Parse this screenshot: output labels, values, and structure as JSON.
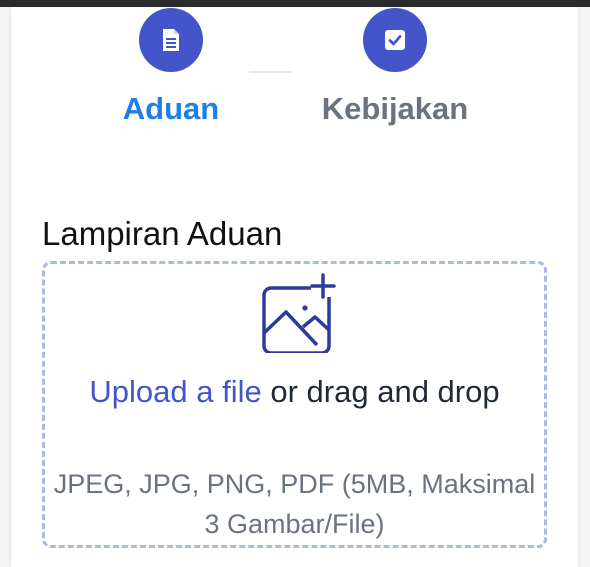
{
  "stepper": {
    "steps": [
      {
        "label": "Aduan",
        "icon": "document-icon",
        "state": "active",
        "label_color": "#1d7fe8"
      },
      {
        "label": "Kebijakan",
        "icon": "checkbox-icon",
        "state": "inactive",
        "label_color": "#6b7280"
      }
    ],
    "accent_color": "#4355c8"
  },
  "attachment": {
    "title": "Lampiran Aduan",
    "upload_link": "Upload a file",
    "upload_text": "or drag and drop",
    "hint": "JPEG, JPG, PNG, PDF (5MB, Maksimal 3 Gambar/File)",
    "icon": "image-add-icon"
  }
}
